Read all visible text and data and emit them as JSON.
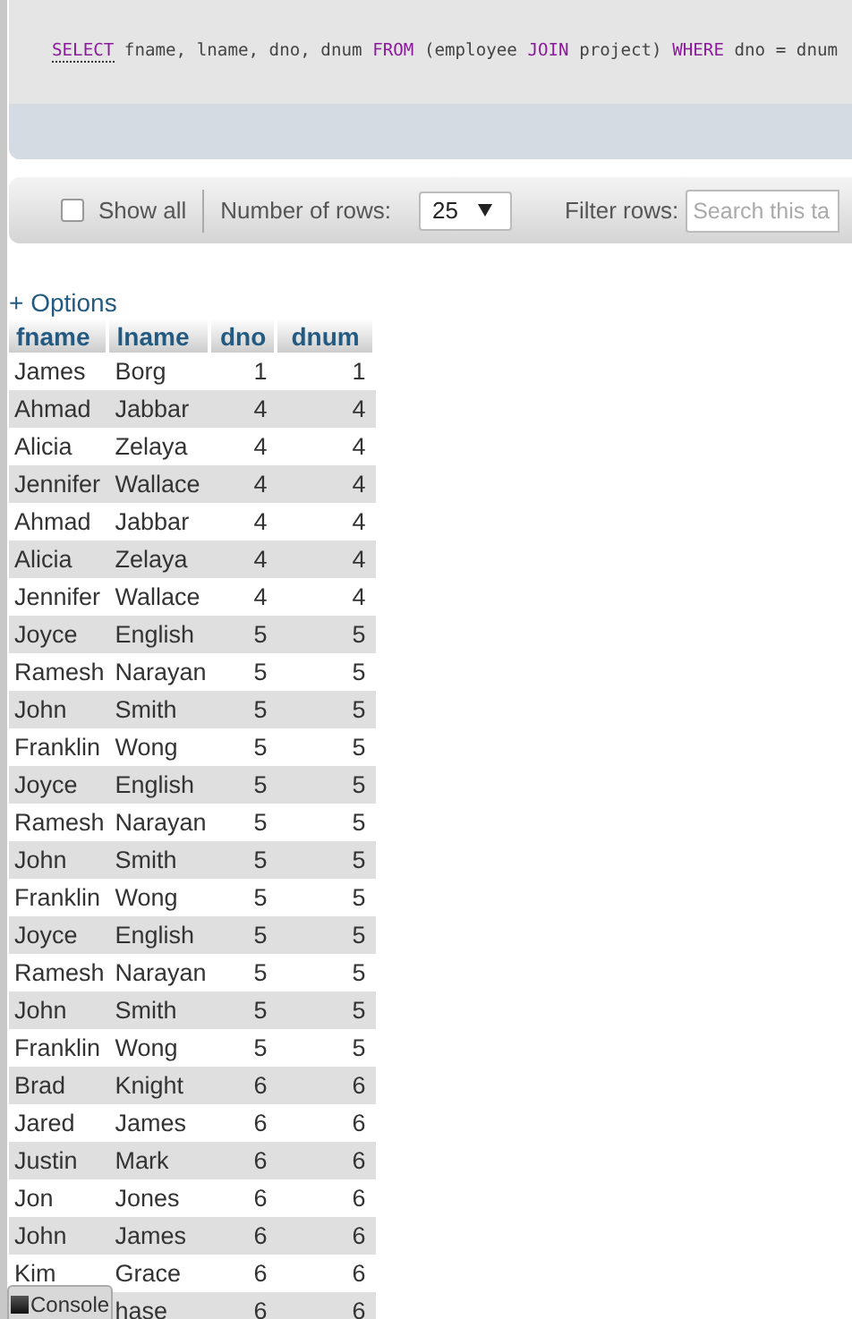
{
  "query": {
    "tokens": [
      {
        "kind": "keyword-link",
        "text": "SELECT"
      },
      {
        "kind": "plain",
        "text": " fname, lname, dno, dnum "
      },
      {
        "kind": "keyword",
        "text": "FROM"
      },
      {
        "kind": "plain",
        "text": " (employee "
      },
      {
        "kind": "keyword",
        "text": "JOIN"
      },
      {
        "kind": "plain",
        "text": " project) "
      },
      {
        "kind": "keyword",
        "text": "WHERE"
      },
      {
        "kind": "plain",
        "text": " dno = dnum"
      }
    ]
  },
  "toolbar": {
    "show_all": {
      "label": "Show all",
      "checked": false
    },
    "rows_label": "Number of rows:",
    "rows_value": "25",
    "filter_label": "Filter rows:",
    "filter_placeholder": "Search this ta"
  },
  "options_link": "+ Options",
  "table": {
    "columns": [
      "fname",
      "lname",
      "dno",
      "dnum"
    ],
    "rows": [
      [
        "James",
        "Borg",
        "1",
        "1"
      ],
      [
        "Ahmad",
        "Jabbar",
        "4",
        "4"
      ],
      [
        "Alicia",
        "Zelaya",
        "4",
        "4"
      ],
      [
        "Jennifer",
        "Wallace",
        "4",
        "4"
      ],
      [
        "Ahmad",
        "Jabbar",
        "4",
        "4"
      ],
      [
        "Alicia",
        "Zelaya",
        "4",
        "4"
      ],
      [
        "Jennifer",
        "Wallace",
        "4",
        "4"
      ],
      [
        "Joyce",
        "English",
        "5",
        "5"
      ],
      [
        "Ramesh",
        "Narayan",
        "5",
        "5"
      ],
      [
        "John",
        "Smith",
        "5",
        "5"
      ],
      [
        "Franklin",
        "Wong",
        "5",
        "5"
      ],
      [
        "Joyce",
        "English",
        "5",
        "5"
      ],
      [
        "Ramesh",
        "Narayan",
        "5",
        "5"
      ],
      [
        "John",
        "Smith",
        "5",
        "5"
      ],
      [
        "Franklin",
        "Wong",
        "5",
        "5"
      ],
      [
        "Joyce",
        "English",
        "5",
        "5"
      ],
      [
        "Ramesh",
        "Narayan",
        "5",
        "5"
      ],
      [
        "John",
        "Smith",
        "5",
        "5"
      ],
      [
        "Franklin",
        "Wong",
        "5",
        "5"
      ],
      [
        "Brad",
        "Knight",
        "6",
        "6"
      ],
      [
        "Jared",
        "James",
        "6",
        "6"
      ],
      [
        "Justin",
        "Mark",
        "6",
        "6"
      ],
      [
        "Jon",
        "Jones",
        "6",
        "6"
      ],
      [
        "John",
        "James",
        "6",
        "6"
      ],
      [
        "Kim",
        "Grace",
        "6",
        "6"
      ],
      [
        null,
        "hase",
        "6",
        "6"
      ]
    ]
  },
  "console": {
    "label": "Console"
  }
}
